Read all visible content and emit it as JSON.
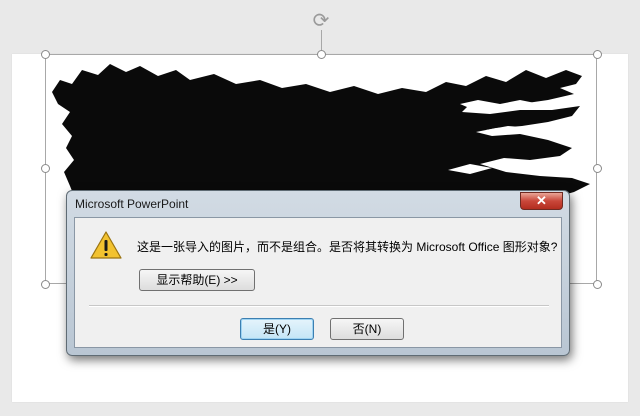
{
  "dialog": {
    "title": "Microsoft PowerPoint",
    "close_symbol": "✕",
    "icon": "warning-icon",
    "message": "这是一张导入的图片，而不是组合。是否将其转换为 Microsoft Office 图形对象?",
    "help_button": "显示帮助(E) >>",
    "yes_button": "是(Y)",
    "no_button": "否(N)"
  },
  "canvas": {
    "rotate_icon": "rotate-icon",
    "shape": "black brush stroke image",
    "colors": {
      "background": "#e9e9e9",
      "slide": "#ffffff",
      "brush": "#0a0a0a"
    }
  }
}
